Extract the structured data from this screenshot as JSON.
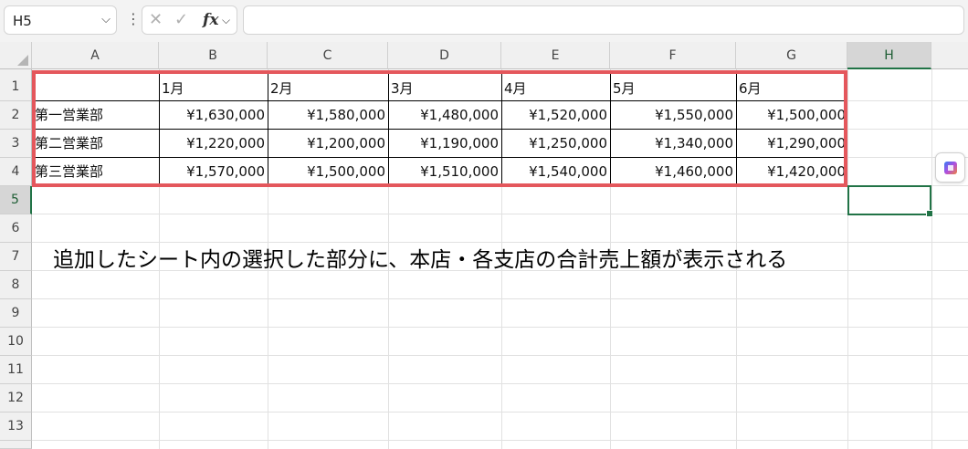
{
  "formula_bar": {
    "name_box": "H5",
    "cancel_icon": "✕",
    "enter_icon": "✓",
    "fx_label": "fx",
    "formula": ""
  },
  "columns": [
    "A",
    "B",
    "C",
    "D",
    "E",
    "F",
    "G",
    "H"
  ],
  "rows": [
    "1",
    "2",
    "3",
    "4",
    "5",
    "6",
    "7",
    "8",
    "9",
    "10",
    "11",
    "12",
    "13"
  ],
  "table": {
    "headers": [
      "",
      "1月",
      "2月",
      "3月",
      "4月",
      "5月",
      "6月"
    ],
    "data": [
      [
        "第一営業部",
        "¥1,630,000",
        "¥1,580,000",
        "¥1,480,000",
        "¥1,520,000",
        "¥1,550,000",
        "¥1,500,000"
      ],
      [
        "第二営業部",
        "¥1,220,000",
        "¥1,200,000",
        "¥1,190,000",
        "¥1,250,000",
        "¥1,340,000",
        "¥1,290,000"
      ],
      [
        "第三営業部",
        "¥1,570,000",
        "¥1,500,000",
        "¥1,510,000",
        "¥1,540,000",
        "¥1,460,000",
        "¥1,420,000"
      ]
    ]
  },
  "annotation": "追加したシート内の選択した部分に、本店・各支店の合計売上額が表示される",
  "colors": {
    "highlight": "#e4575c",
    "selection": "#217346"
  },
  "icons": {
    "copilot": "copilot-icon"
  }
}
